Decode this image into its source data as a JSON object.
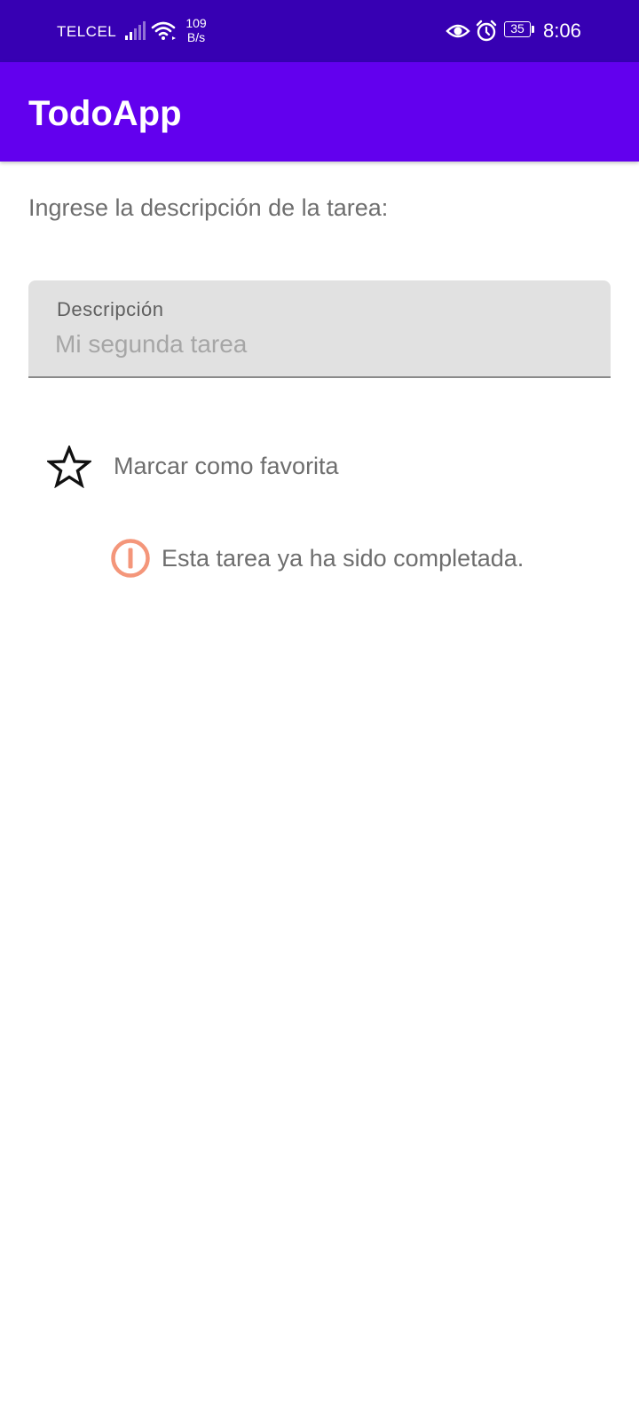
{
  "status_bar": {
    "carrier": "TELCEL",
    "net_speed_value": "109",
    "net_speed_unit": "B/s",
    "battery_level": "35",
    "time": "8:06",
    "icons": [
      "signal-icon",
      "wifi-icon",
      "eye-icon",
      "alarm-icon",
      "battery-icon"
    ]
  },
  "app_bar": {
    "title": "TodoApp"
  },
  "form": {
    "prompt": "Ingrese la descripción de la tarea:",
    "description_field": {
      "label": "Descripción",
      "value": "",
      "placeholder": "Mi segunda tarea"
    },
    "favorite": {
      "label": "Marcar como favorita",
      "checked": false,
      "icon": "star-outline-icon"
    },
    "status_message": {
      "text": "Esta tarea ya ha sido completada.",
      "icon": "warning-icon"
    }
  },
  "colors": {
    "status_bar": "#3700b3",
    "app_bar": "#6200ee",
    "warning": "#f4967a"
  }
}
